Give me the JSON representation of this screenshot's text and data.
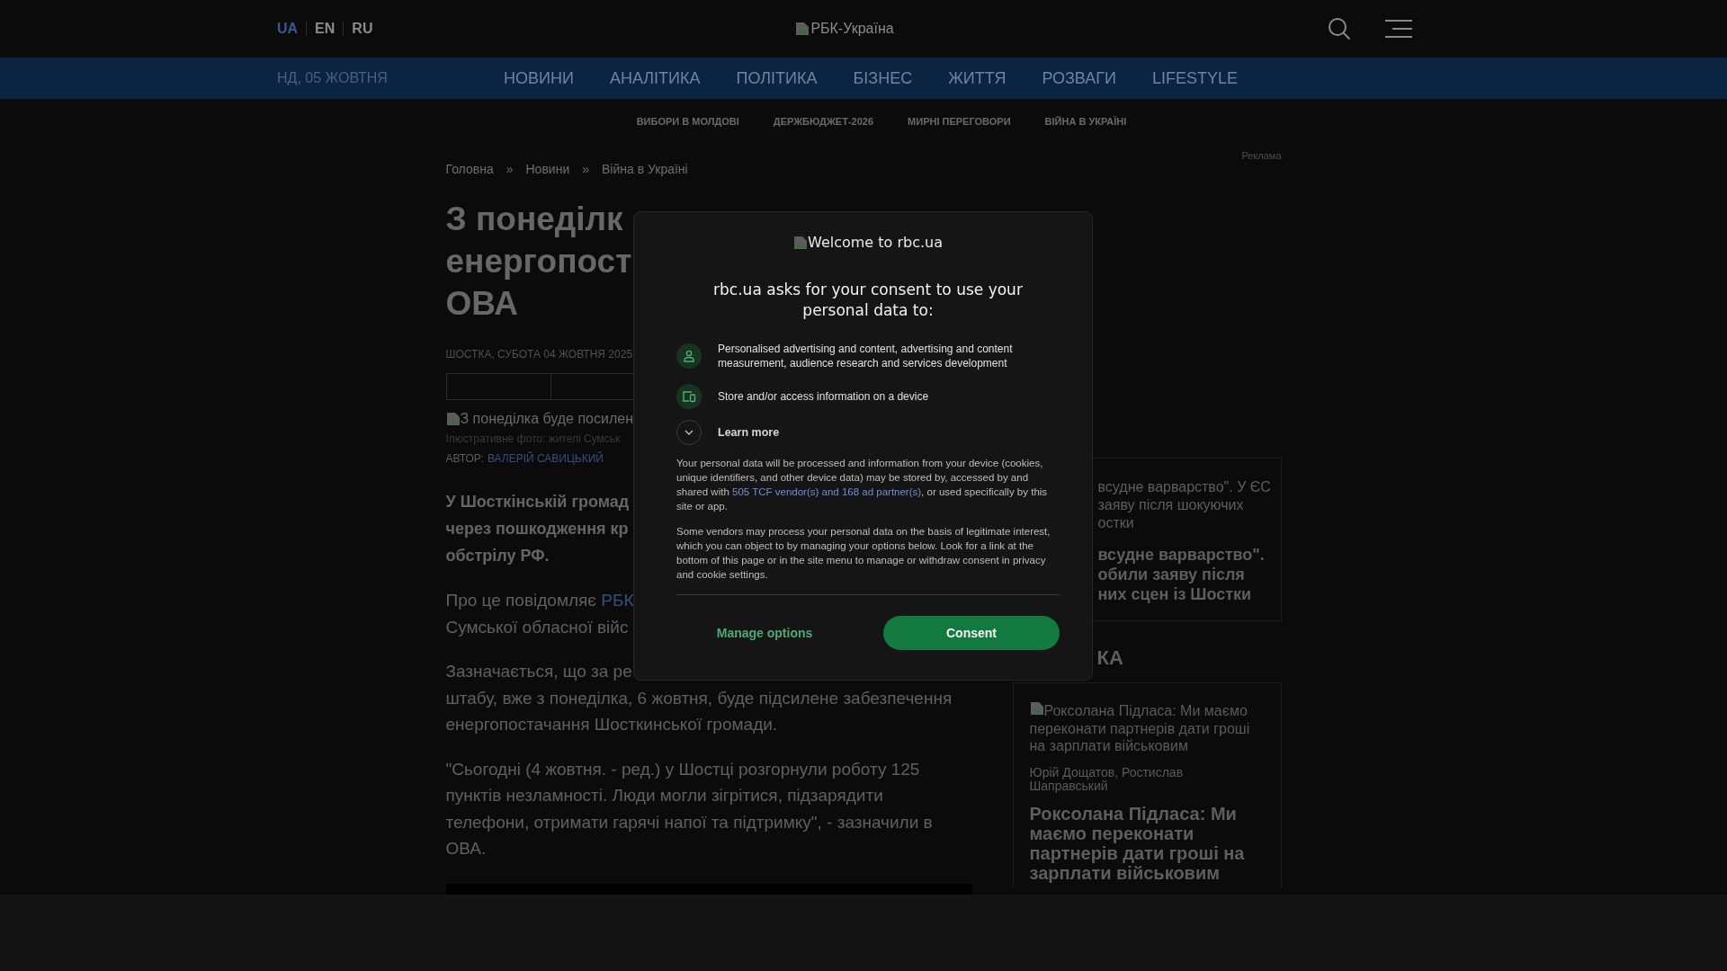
{
  "header": {
    "languages": [
      {
        "label": "UA",
        "selected": true
      },
      {
        "label": "EN",
        "selected": false
      },
      {
        "label": "RU",
        "selected": false
      }
    ],
    "logo_alt": "РБК-Україна"
  },
  "nav": {
    "date": "НД, 05 ЖОВТНЯ",
    "items": [
      "НОВИНИ",
      "АНАЛІТИКА",
      "ПОЛІТИКА",
      "БІЗНЕС",
      "ЖИТТЯ",
      "РОЗВАГИ",
      "LIFESTYLE"
    ]
  },
  "tags": [
    "ВИБОРИ В МОЛДОВІ",
    "ДЕРЖБЮДЖЕТ-2026",
    "МИРНІ ПЕРЕГОВОРИ",
    "ВІЙНА В УКРАЇНІ"
  ],
  "ad_label": "Реклама",
  "breadcrumbs": {
    "separator": "»",
    "items": [
      "Головна",
      "Новини",
      "Війна в Україні"
    ]
  },
  "article": {
    "title_lines": [
      "З понеділк",
      "енергопост",
      "ОВА"
    ],
    "meta": "ШОСТКА, СУБОТА 04 ЖОВТНЯ 2025",
    "image_alt": "З понеділка буде посилен",
    "caption": "Ілюстративне фото: жителі Сумськ",
    "author_label": "АВТОР:",
    "author": "ВАЛЕРІЙ САВИЦЬКИЙ",
    "lead_lines": [
      "У Шосткінській громад",
      "через пошкодження кр",
      "обстрілу РФ."
    ],
    "paragraphs": [
      {
        "lines": [
          [
            {
              "kind": "text",
              "text": "Про це повідомляє "
            },
            {
              "kind": "link",
              "text": "РБК"
            }
          ],
          [
            {
              "kind": "text",
              "text": "Сумської обласної війс"
            }
          ]
        ]
      },
      {
        "lines": [
          [
            {
              "kind": "text",
              "text": "Зазначається, що за ре"
            }
          ],
          [
            {
              "kind": "text",
              "text": "штабу, вже з понеділка, 6 жовтня, буде підсилене забезпечення"
            }
          ],
          [
            {
              "kind": "text",
              "text": "енергопостачання Шосткинської громади."
            }
          ]
        ]
      },
      {
        "lines": [
          [
            {
              "kind": "text",
              "text": "\"Сьогодні (4 жовтня. - ред.) у Шостці розгорнули роботу 125"
            }
          ],
          [
            {
              "kind": "text",
              "text": "пунктів незламності. Люди могли зігрітися, підзарядити"
            }
          ],
          [
            {
              "kind": "text",
              "text": "телефони, отримати гарячі напої та підтримку\", - зазначили в"
            }
          ],
          [
            {
              "kind": "text",
              "text": "ОВА."
            }
          ]
        ]
      }
    ]
  },
  "sidebar": {
    "card_1": {
      "image_alt_lines": [
        "всудне варварство\". У ЄС",
        "заяву після шокуючих",
        "остки"
      ],
      "title_lines": [
        "всудне варварство\".",
        "обили заяву після",
        "них сцен із Шостки"
      ]
    },
    "section_heading": "КА",
    "card_2": {
      "image_alt": "Роксолана Підласа: Ми маємо переконати партнерів дати гроші на зарплати військовим",
      "authors": "Юрій Дощатов, Ростислав Шаправський",
      "title": "Роксолана Підласа: Ми маємо переконати партнерів дати гроші на зарплати військовим"
    }
  },
  "consent": {
    "logo_alt": "Welcome to rbc.ua",
    "title": "rbc.ua asks for your consent to use your personal data to:",
    "purposes": [
      {
        "kind": "person",
        "text": "Personalised advertising and content, advertising and content measurement, audience research and services development"
      },
      {
        "kind": "device",
        "text": "Store and/or access information on a device"
      }
    ],
    "learn_more": {
      "label": "Learn more",
      "expanded": false
    },
    "paragraphs": [
      [
        {
          "kind": "text",
          "text": "Your personal data will be processed and information from your device (cookies, unique identifiers, and other device data) may be stored by, accessed by and shared with "
        },
        {
          "kind": "link",
          "text": "505 TCF vendor(s) and 168 ad partner(s)"
        },
        {
          "kind": "text",
          "text": ", or used specifically by this site or app."
        }
      ],
      [
        {
          "kind": "text",
          "text": "Some vendors may process your personal data on the basis of legitimate interest, which you can object to by managing your options below. Look for a link at the bottom of this page or in the site menu to manage or withdraw consent in privacy and cookie settings."
        }
      ]
    ],
    "manage_label": "Manage options",
    "consent_label": "Consent"
  }
}
